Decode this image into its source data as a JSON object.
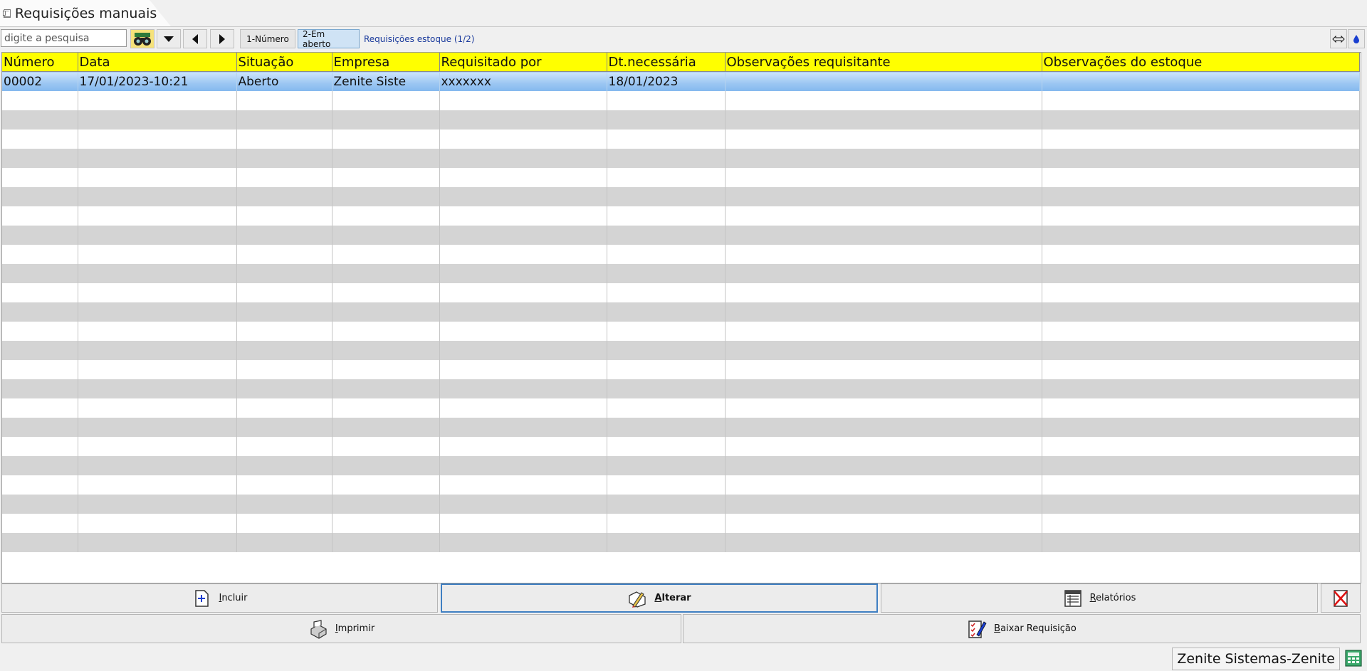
{
  "tab": {
    "title": "Requisições manuais",
    "close": "×",
    "icon": "book-icon"
  },
  "toolbar": {
    "search_placeholder": "digite a pesquisa",
    "filters": [
      "1-Número",
      "2-Em aberto"
    ],
    "active_filter": "2-Em aberto",
    "status": "Requisições estoque (1/2)"
  },
  "grid": {
    "columns": [
      "Número",
      "Data",
      "Situação",
      "Empresa",
      "Requisitado por",
      "Dt.necessária",
      "Observações requisitante",
      "Observações do estoque"
    ],
    "rows": [
      [
        "00002",
        "17/01/2023-10:21",
        "Aberto",
        "Zenite Siste",
        "xxxxxxx",
        "18/01/2023",
        "",
        ""
      ]
    ]
  },
  "actions": {
    "incluir": "Incluir",
    "alterar": "Alterar",
    "relatorios": "Relatórios",
    "imprimir": "Imprimir",
    "baixar": "Baixar Requisição"
  },
  "statusbar": {
    "company": "Zenite Sistemas-Zenite"
  },
  "colors": {
    "header_bg": "#ffff00",
    "selected_row": "#9bc6f2",
    "stripe": "#d4d4d4"
  }
}
